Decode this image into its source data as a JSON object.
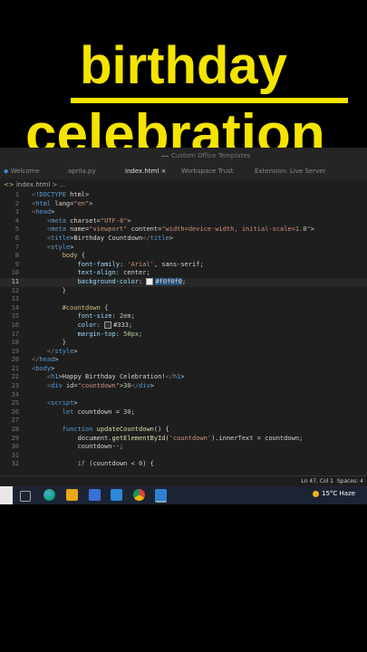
{
  "overlay": {
    "line1": "birthday",
    "line2": "celebration"
  },
  "window": {
    "title": "Custom Office Templates"
  },
  "tabs": [
    {
      "label": "Welcome"
    },
    {
      "label": "aprila.py"
    },
    {
      "label": "index.html"
    },
    {
      "label": "Workspace Trust"
    },
    {
      "label": "Extension: Live Server"
    }
  ],
  "breadcrumb": {
    "file": "index.html",
    "rest": " > ..."
  },
  "code_lines": [
    "<!DOCTYPE html>",
    "<html lang=\"en\">",
    "<head>",
    "    <meta charset=\"UTF-8\">",
    "    <meta name=\"viewport\" content=\"width=device-width, initial-scale=1.0\">",
    "    <title>Birthday Countdown</title>",
    "    <style>",
    "        body {",
    "            font-family: 'Arial', sans-serif;",
    "            text-align: center;",
    "            background-color: #f0f0f0;",
    "        }",
    "",
    "        #countdown {",
    "            font-size: 2em;",
    "            color: #333;",
    "            margin-top: 50px;",
    "        }",
    "    </style>",
    "</head>",
    "<body>",
    "    <h1>Happy Birthday Celebration!</h1>",
    "    <div id=\"countdown\">30</div>",
    "",
    "    <script>",
    "        let countdown = 30;",
    "",
    "        function updateCountdown() {",
    "            document.getElementById('countdown').innerText = countdown;",
    "            countdown--;",
    "",
    "            if (countdown < 0) {"
  ],
  "current_line": 11,
  "status": {
    "position": "Ln 47, Col 1",
    "spaces": "Spaces: 4"
  },
  "taskbar": {
    "weather_temp": "15°C",
    "weather_desc": "Haze"
  },
  "colors": {
    "headline": "#f5e400",
    "editor_bg": "#1e1e1e",
    "taskbar_bg": "#1c2433"
  }
}
